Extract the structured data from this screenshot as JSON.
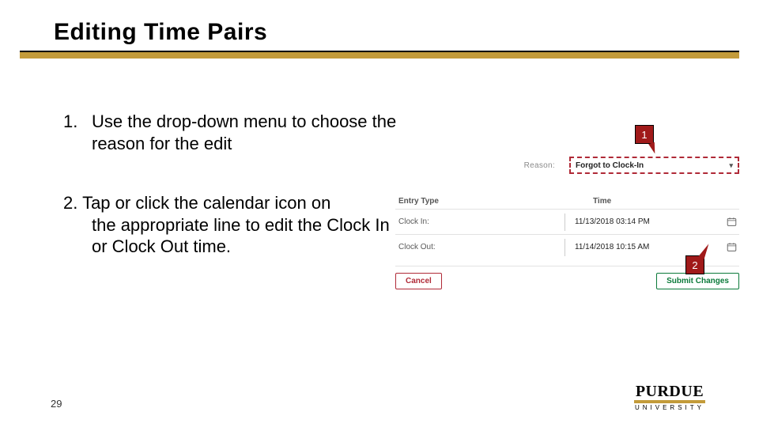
{
  "title": "Editing Time Pairs",
  "steps": {
    "s1": {
      "num": "1.",
      "text": "Use the drop-down menu to choose the reason for the edit"
    },
    "s2": {
      "lead": "2. Tap or click the calendar icon on",
      "rest": "the appropriate line to edit the Clock In or Clock Out time."
    }
  },
  "reason": {
    "label": "Reason:",
    "value": "Forgot to Clock-In"
  },
  "entries": {
    "headers": {
      "type": "Entry Type",
      "time": "Time"
    },
    "rows": [
      {
        "type": "Clock In:",
        "time": "11/13/2018 03:14 PM"
      },
      {
        "type": "Clock Out:",
        "time": "11/14/2018 10:15 AM"
      }
    ]
  },
  "buttons": {
    "cancel": "Cancel",
    "submit": "Submit Changes"
  },
  "callouts": {
    "c1": "1",
    "c2": "2"
  },
  "page": "29",
  "logo": {
    "brand": "PURDUE",
    "sub": "UNIVERSITY"
  }
}
